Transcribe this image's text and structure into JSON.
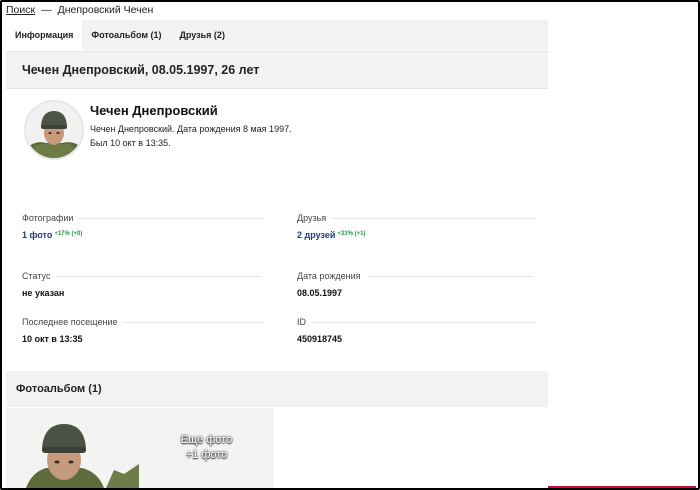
{
  "breadcrumb": {
    "root": "Поиск",
    "separator": "—",
    "current": "Днепровский Чечен"
  },
  "tabs": [
    {
      "label": "Информация",
      "active": true
    },
    {
      "label": "Фотоальбом (1)",
      "active": false
    },
    {
      "label": "Друзья (2)",
      "active": false
    }
  ],
  "header": {
    "title": "Чечен Днепровский, 08.05.1997, 26 лет"
  },
  "profile": {
    "name": "Чечен Днепровский",
    "description": "Чечен Днепровский. Дата рождения 8 мая 1997.",
    "last_seen": "Был 10 окт в 13:35."
  },
  "fields": {
    "photos": {
      "label": "Фотографии",
      "value": "1 фото",
      "delta": "+17% (+0)"
    },
    "friends": {
      "label": "Друзья",
      "value": "2 друзей",
      "delta": "+33% (+1)"
    },
    "status": {
      "label": "Статус",
      "value": "не указан"
    },
    "birthdate": {
      "label": "Дата рождения",
      "value": "08.05.1997"
    },
    "last_visit": {
      "label": "Последнее посещение",
      "value": "10 окт в 13:35"
    },
    "id": {
      "label": "ID",
      "value": "450918745"
    }
  },
  "album": {
    "title": "Фотоальбом (1)",
    "more_line1": "Еще фото",
    "more_line2": "+1 фото"
  },
  "colors": {
    "link": "#1f3b7a",
    "delta": "#1f9d3a",
    "bar": "#f1f2f4"
  }
}
